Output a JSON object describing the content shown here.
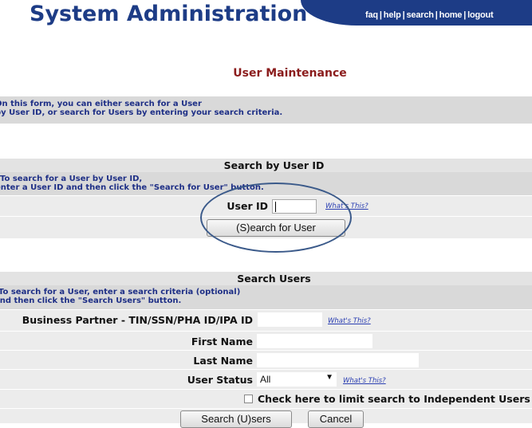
{
  "header": {
    "title": "System Administration",
    "nav": [
      "faq",
      "help",
      "search",
      "home",
      "logout"
    ],
    "separator": "|"
  },
  "page": {
    "title": "User Maintenance",
    "intro_line1": "On this form, you can either search for a User",
    "intro_line2": "by User ID, or search for Users by entering your search criteria."
  },
  "search_by_id": {
    "title": "Search by User ID",
    "instructions_line1": "To search for a User by User ID,",
    "instructions_line2": "enter a User ID and then click the \"Search for User\" button.",
    "user_id_label": "User ID",
    "user_id_value": "",
    "help_link": "What's This?",
    "button_label": "(S)earch for User"
  },
  "search_users": {
    "title": "Search Users",
    "instructions_line1": "To search for a User, enter a search criteria (optional)",
    "instructions_line2": "and then click the \"Search Users\" button.",
    "partner_label": "Business Partner - TIN/SSN/PHA ID/IPA ID",
    "partner_value": "",
    "partner_help": "What's This?",
    "first_name_label": "First Name",
    "first_name_value": "",
    "last_name_label": "Last Name",
    "last_name_value": "",
    "status_label": "User Status",
    "status_value": "All",
    "status_help": "What's This?",
    "independent_checkbox_label": "Check here to limit search to Independent Users",
    "independent_checked": false,
    "search_button_label": "Search (U)sers",
    "cancel_button_label": "Cancel"
  },
  "colors": {
    "brand": "#1d3c86",
    "title_red": "#8b1c1c",
    "link": "#2b3fb2",
    "band": "#d9d9d9",
    "highlight_ring": "#3b5a8a"
  },
  "icons": {
    "dropdown": "triangle-down",
    "highlight": "ellipse-ring"
  }
}
